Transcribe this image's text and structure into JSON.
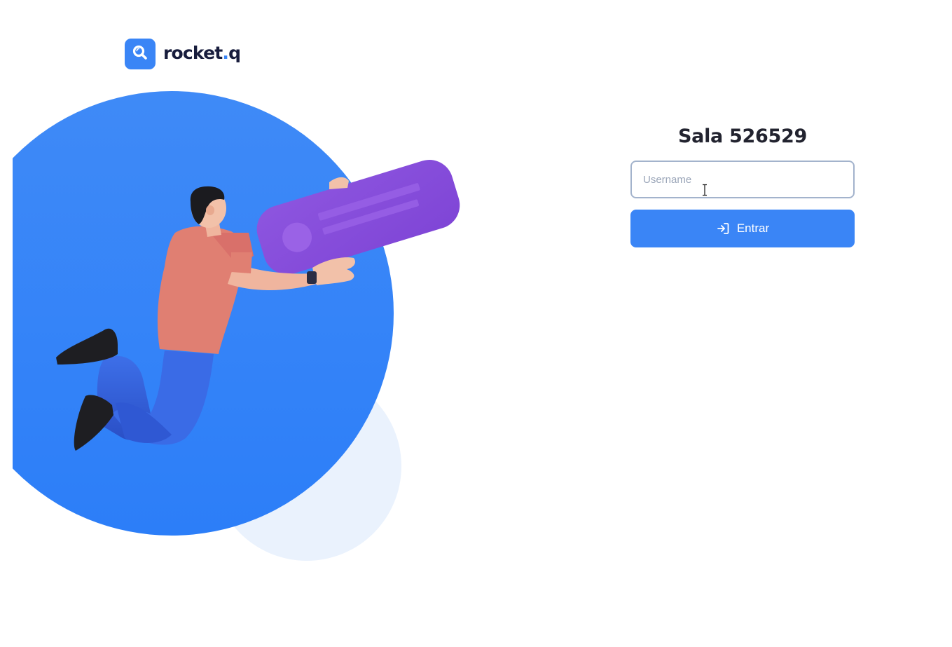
{
  "brand": {
    "name_main": "rocket",
    "name_dot": ".",
    "name_suffix": "q",
    "accent_color": "#3a85f6",
    "text_color": "#181d3d",
    "logo_icon": "search-magnifier-icon"
  },
  "room": {
    "title": "Sala 526529"
  },
  "form": {
    "username_placeholder": "Username",
    "username_value": "",
    "enter_label": "Entrar",
    "enter_icon": "sign-in-icon"
  },
  "colors": {
    "primary": "#3a85f6",
    "card_purple": "#8a4fdb",
    "pale_circle": "#eaf2fd",
    "input_border": "#a3b3cc"
  }
}
